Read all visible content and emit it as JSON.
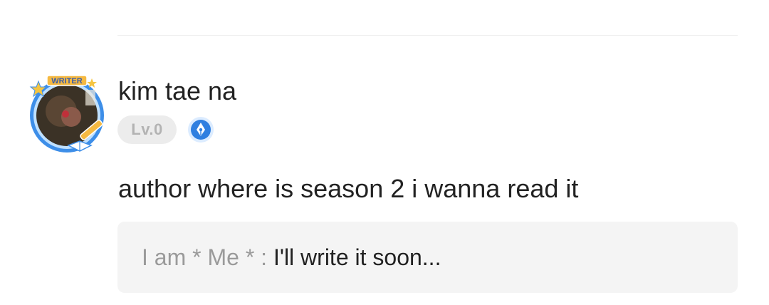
{
  "avatar": {
    "frame_label": "WRITER",
    "frame_color": "#4a90e2",
    "accent_color": "#f5b942"
  },
  "user": {
    "name": "kim tae na",
    "level": "Lv.0",
    "badge_icon": "writer-pen-icon",
    "badge_color": "#2f7fe0"
  },
  "comment": {
    "text": "author where is season 2 i wanna read it"
  },
  "reply": {
    "author": "I am * Me *",
    "separator": " : ",
    "text": "I'll write it soon..."
  }
}
